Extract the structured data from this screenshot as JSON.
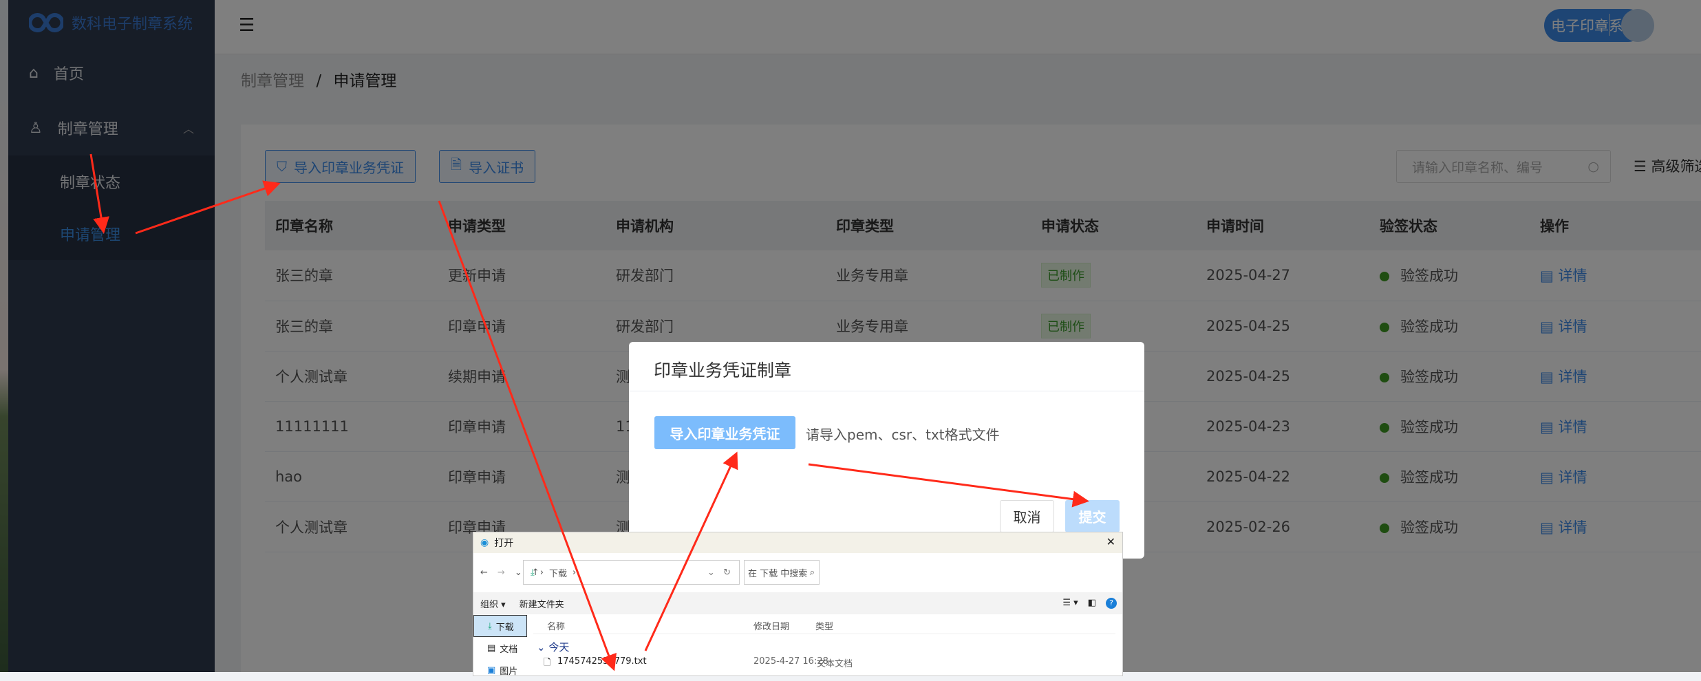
{
  "app": {
    "title": "数科电子制章系统",
    "system_button": "电子印章系统"
  },
  "sidebar": {
    "items": [
      {
        "label": "首页"
      },
      {
        "label": "制章管理",
        "children": [
          {
            "label": "制章状态"
          },
          {
            "label": "申请管理",
            "active": true
          }
        ]
      }
    ]
  },
  "breadcrumb": {
    "parent": "制章管理",
    "separator": "/",
    "current": "申请管理"
  },
  "toolbar": {
    "import_voucher": "导入印章业务凭证",
    "import_cert": "导入证书",
    "search_placeholder": "请输入印章名称、编号",
    "advanced_filter": "高级筛选"
  },
  "table": {
    "headers": [
      "印章名称",
      "申请类型",
      "申请机构",
      "印章类型",
      "申请状态",
      "申请时间",
      "验签状态",
      "操作"
    ],
    "rows": [
      {
        "name": "张三的章",
        "type": "更新申请",
        "org": "研发部门",
        "seal_type": "业务专用章",
        "status": "已制作",
        "time": "2025-04-27",
        "verify": "验签成功",
        "action": "详情"
      },
      {
        "name": "张三的章",
        "type": "印章申请",
        "org": "研发部门",
        "seal_type": "业务专用章",
        "status": "已制作",
        "time": "2025-04-25",
        "verify": "验签成功",
        "action": "详情"
      },
      {
        "name": "个人测试章",
        "type": "续期申请",
        "org": "测",
        "seal_type": "",
        "status": "",
        "time": "2025-04-25",
        "verify": "验签成功",
        "action": "详情"
      },
      {
        "name": "11111111",
        "type": "印章申请",
        "org": "11",
        "seal_type": "",
        "status": "",
        "time": "2025-04-23",
        "verify": "验签成功",
        "action": "详情"
      },
      {
        "name": "hao",
        "type": "印章申请",
        "org": "测",
        "seal_type": "",
        "status": "",
        "time": "2025-04-22",
        "verify": "验签成功",
        "action": "详情"
      },
      {
        "name": "个人测试章",
        "type": "印章申请",
        "org": "测",
        "seal_type": "",
        "status": "",
        "time": "2025-02-26",
        "verify": "验签成功",
        "action": "详情"
      }
    ]
  },
  "modal": {
    "title": "印章业务凭证制章",
    "upload_button": "导入印章业务凭证",
    "hint": "请导入pem、csr、txt格式文件",
    "cancel": "取消",
    "submit": "提交"
  },
  "file_dialog": {
    "title": "打开",
    "path": "下载",
    "search_placeholder": "在 下载 中搜索",
    "organize": "组织 ▾",
    "new_folder": "新建文件夹",
    "nav": [
      "下载",
      "文档",
      "图片"
    ],
    "columns": [
      "名称",
      "修改日期",
      "类型"
    ],
    "group": "今天",
    "file": {
      "name": "1745742535779.txt",
      "date": "2025-4-27 16:28",
      "type": "文本文档"
    }
  },
  "colors": {
    "accent": "#3d8be8",
    "sidebar": "#2f3a4f",
    "success": "#3f9a22",
    "arrow": "#ff2a1a"
  }
}
